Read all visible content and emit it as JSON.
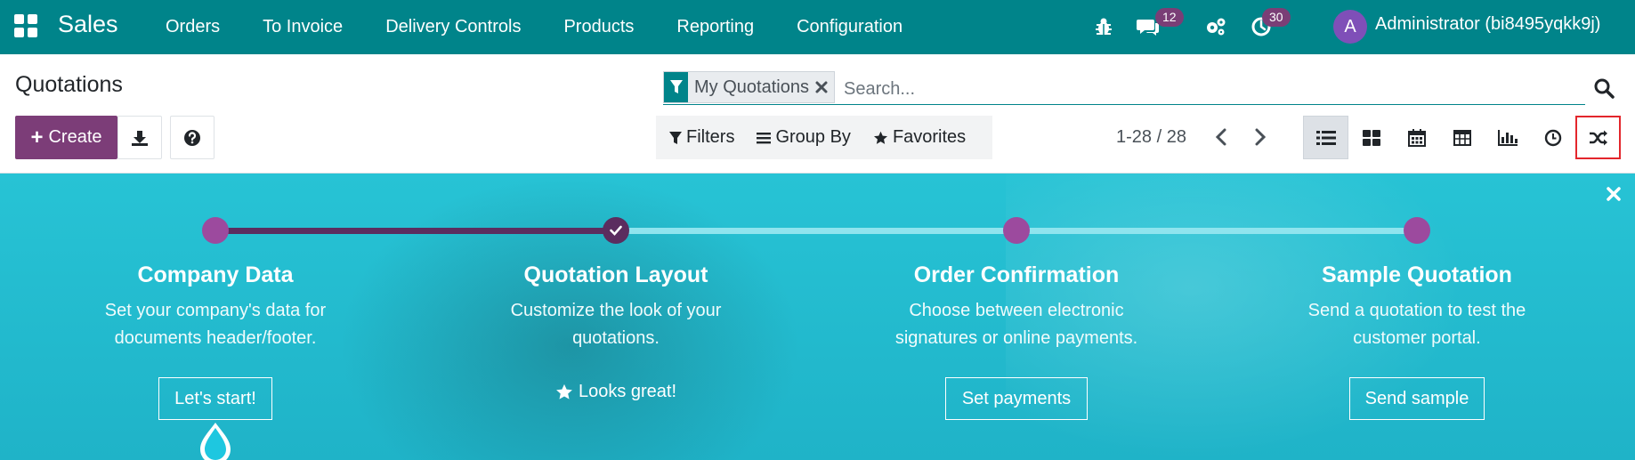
{
  "navbar": {
    "app_name": "Sales",
    "menu": [
      "Orders",
      "To Invoice",
      "Delivery Controls",
      "Products",
      "Reporting",
      "Configuration"
    ],
    "messages_count": "12",
    "activities_count": "30",
    "avatar_letter": "A",
    "user": "Administrator (bi8495yqkk9j)",
    "icons": [
      "apps-icon",
      "bug-icon",
      "chat-icon",
      "settings-icon",
      "clock-icon"
    ]
  },
  "control_panel": {
    "title": "Quotations",
    "create_label": "Create",
    "search": {
      "facet_label": "My Quotations",
      "placeholder": "Search..."
    },
    "filters_label": "Filters",
    "groupby_label": "Group By",
    "favorites_label": "Favorites",
    "pager": "1-28 / 28",
    "views": [
      "list",
      "kanban",
      "calendar",
      "pivot",
      "graph",
      "activity",
      "cohort"
    ],
    "active_view": "list",
    "highlighted_view": "cohort"
  },
  "onboarding": {
    "steps": [
      {
        "title": "Company Data",
        "desc_lines": [
          "Set your company's data for",
          "documents header/footer."
        ],
        "button": "Let's start!"
      },
      {
        "title": "Quotation Layout",
        "desc_lines": [
          "Customize the look of your",
          "quotations."
        ],
        "done_label": "Looks great!"
      },
      {
        "title": "Order Confirmation",
        "desc_lines": [
          "Choose between electronic",
          "signatures or online payments."
        ],
        "button": "Set payments"
      },
      {
        "title": "Sample Quotation",
        "desc_lines": [
          "Send a quotation to test the",
          "customer portal."
        ],
        "button": "Send sample"
      }
    ]
  },
  "colors": {
    "navbar": "#00848a",
    "primary": "#7c3d78",
    "banner": "#27c3d5",
    "highlight_border": "#e3262c"
  }
}
